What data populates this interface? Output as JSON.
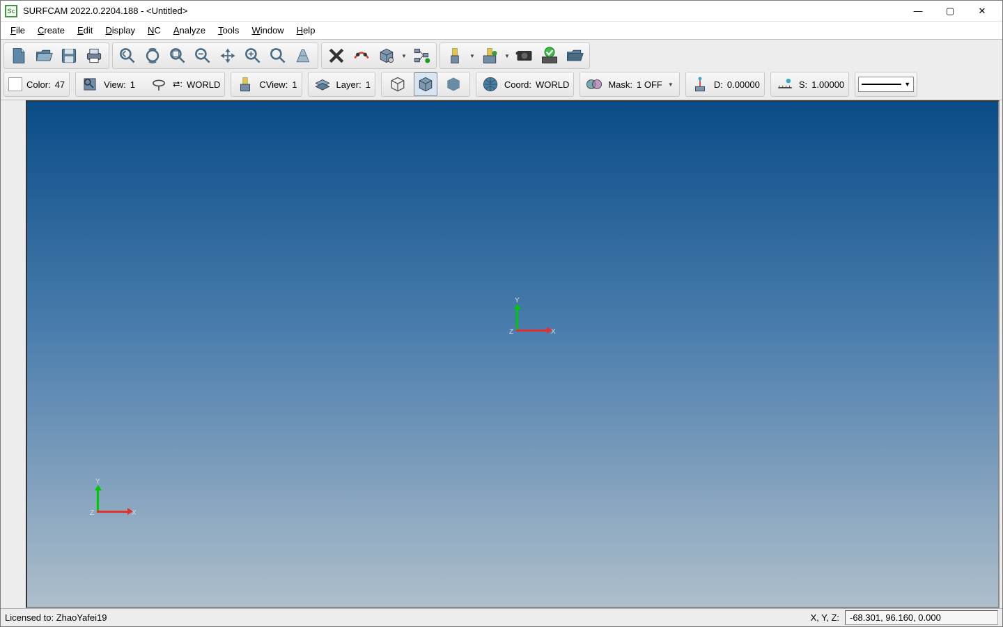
{
  "title": "SURFCAM 2022.0.2204.188  -  <Untitled>",
  "app_icon_text": "Sc",
  "menus": [
    "File",
    "Create",
    "Edit",
    "Display",
    "NC",
    "Analyze",
    "Tools",
    "Window",
    "Help"
  ],
  "toolbar1_icons": [
    "new-file-icon",
    "open-file-icon",
    "save-icon",
    "print-icon",
    "zoom-previous-icon",
    "zoom-rotate-icon",
    "zoom-window-icon",
    "zoom-out-icon",
    "pan-icon",
    "zoom-in-tool-icon",
    "zoom-extent-icon",
    "refresh-icon",
    "delete-icon",
    "curve-break-icon",
    "box-set-icon",
    "hierarchy-icon",
    "stock-tool-icon",
    "tool-config-icon",
    "video-icon",
    "verify-icon",
    "post-icon"
  ],
  "status_panels": {
    "color_label": "Color:",
    "color_value": "47",
    "view_label": "View:",
    "view_value": "1",
    "orientation_glyph": "⮂:",
    "orientation_value": "WORLD",
    "cview_label": "CView:",
    "cview_value": "1",
    "layer_label": "Layer:",
    "layer_value": "1",
    "coord_label": "Coord:",
    "coord_value": "WORLD",
    "mask_label": "Mask:",
    "mask_value": "1 OFF",
    "d_label": "D:",
    "d_value": "0.00000",
    "s_label": "S:",
    "s_value": "1.00000"
  },
  "axis_labels": {
    "x": "X",
    "y": "Y",
    "z": "Z"
  },
  "statusbar": {
    "license": "Licensed to: ZhaoYafei19",
    "coord_label": "X, Y, Z:",
    "coord_value": "-68.301, 96.160, 0.000"
  }
}
